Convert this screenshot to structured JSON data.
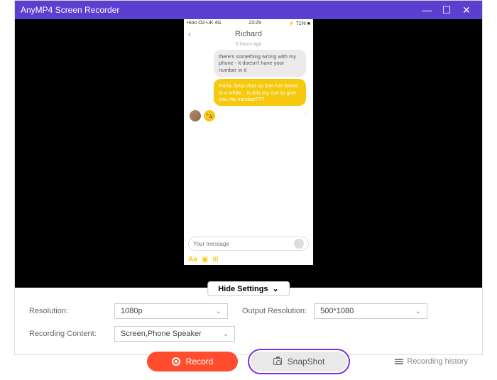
{
  "titlebar": {
    "title": "AnyMP4 Screen Recorder"
  },
  "phone": {
    "status_left": "•ooo O2-UK 4G",
    "status_time": "23:29",
    "status_right": "⚡ 71% ■",
    "contact": "Richard",
    "time_ago": "5 hours ago",
    "msg1": "there's something wrong with my phone - it doesn't have your number in it",
    "msg2": "Haha, best chat up line I've heard in a while... is this my cue to give you my number???",
    "placeholder": "Your message",
    "aa": "Aa"
  },
  "hide_settings": "Hide Settings",
  "settings": {
    "resolution_label": "Resolution:",
    "resolution_value": "1080p",
    "output_label": "Output Resolution:",
    "output_value": "500*1080",
    "content_label": "Recording Content:",
    "content_value": "Screen,Phone Speaker"
  },
  "actions": {
    "record": "Record",
    "snapshot": "SnapShot",
    "history": "Recording history"
  }
}
